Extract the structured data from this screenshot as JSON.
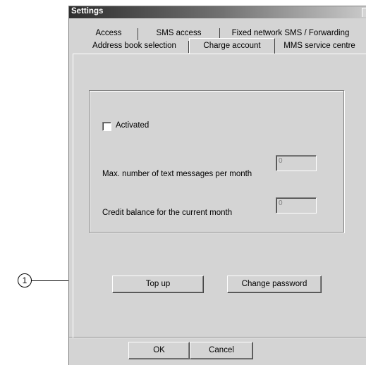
{
  "window": {
    "title": "Settings"
  },
  "tabs": {
    "row1": [
      "Access",
      "SMS access",
      "Fixed network SMS / Forwarding"
    ],
    "row2": [
      "Address book selection",
      "Charge account",
      "MMS service centre"
    ],
    "active": "Charge account"
  },
  "charge_account": {
    "activated_label": "Activated",
    "activated_checked": false,
    "max_messages_label": "Max. number of text messages per month",
    "max_messages_value": "0",
    "credit_balance_label": "Credit balance for the current month",
    "credit_balance_value": "0",
    "top_up_label": "Top up",
    "change_password_label": "Change password"
  },
  "footer": {
    "ok_label": "OK",
    "cancel_label": "Cancel"
  },
  "callout": {
    "number": "1"
  }
}
